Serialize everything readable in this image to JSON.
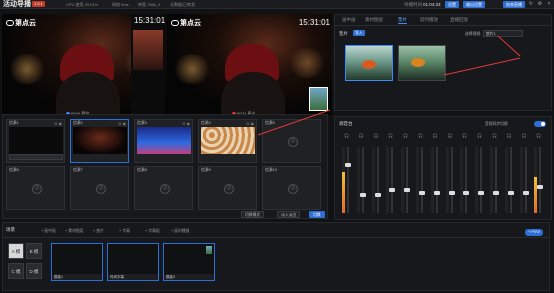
{
  "app": {
    "title": "活动导播",
    "version_badge": "1.0.1",
    "stats": [
      "CPU 使用 29.01%",
      "网络 0ms",
      "带宽 768k_0",
      "无数据/已转发"
    ],
    "clock_label": "导播时间",
    "clock": "01:04:33",
    "buttons": {
      "setting": "设置",
      "output": "输出设置",
      "end": "结束直播"
    }
  },
  "preview": {
    "logo": "第点云",
    "timecode": "15:31:01",
    "label": "PVW 预览"
  },
  "program": {
    "logo": "第点云",
    "timecode": "15:31:01",
    "label": "PGM 直出"
  },
  "sources": {
    "cells": [
      {
        "label": "信源1",
        "ctl": "⊖ ◉"
      },
      {
        "label": "信源2",
        "ctl": "⊖ ◉"
      },
      {
        "label": "信源3",
        "ctl": "⊖ ◉"
      },
      {
        "label": "信源4",
        "ctl": "⊖ ◉"
      },
      {
        "label": "信源5",
        "ctl": ""
      },
      {
        "label": "信源6",
        "ctl": ""
      },
      {
        "label": "信源7",
        "ctl": ""
      },
      {
        "label": "信源8",
        "ctl": ""
      },
      {
        "label": "信源9",
        "ctl": ""
      },
      {
        "label": "信源10",
        "ctl": ""
      }
    ],
    "buttons": {
      "transition": "切换模式",
      "fade": "淡入淡出",
      "cut": "切换"
    }
  },
  "right_panel": {
    "tabs": [
      "画中画",
      "素材图层",
      "垫片",
      "延时播放",
      "直播回放"
    ],
    "section_title": "垫片",
    "import_btn": "导入",
    "select_label": "选择视频:",
    "select_value": "垫片1"
  },
  "mixer": {
    "title": "调音台",
    "sync_label": "音频同步切换",
    "channels": [
      {
        "name": "主",
        "level": 0.62
      },
      {
        "name": "1",
        "level": 0.0
      },
      {
        "name": "2",
        "level": 0.0
      },
      {
        "name": "3",
        "level": 0.0
      },
      {
        "name": "4",
        "level": 0.0
      },
      {
        "name": "5",
        "level": 0.0
      },
      {
        "name": "6",
        "level": 0.0
      },
      {
        "name": "7",
        "level": 0.0
      },
      {
        "name": "8",
        "level": 0.0
      },
      {
        "name": "9",
        "level": 0.0
      },
      {
        "name": "10",
        "level": 0.0
      },
      {
        "name": "11",
        "level": 0.0
      },
      {
        "name": "12",
        "level": 0.0
      },
      {
        "name": "PGM",
        "level": 0.55
      }
    ],
    "fader_levels": [
      0.72,
      0.28,
      0.28,
      0.35,
      0.35,
      0.3,
      0.3,
      0.3,
      0.3,
      0.3,
      0.3,
      0.3,
      0.3,
      0.4
    ]
  },
  "dock": {
    "title": "场景",
    "tools": [
      "+ 画中画",
      "+ 素材图层",
      "+ 垫片",
      "+ 字幕",
      "+ 字幕组",
      "+ 延时播放"
    ],
    "layouts": [
      "A 模",
      "B 模",
      "C 模",
      "D 模"
    ],
    "templates": [
      {
        "label": "模板1"
      },
      {
        "label": "时间字幕"
      },
      {
        "label": "模板3"
      }
    ],
    "pgm_btn": "+ PVW"
  }
}
